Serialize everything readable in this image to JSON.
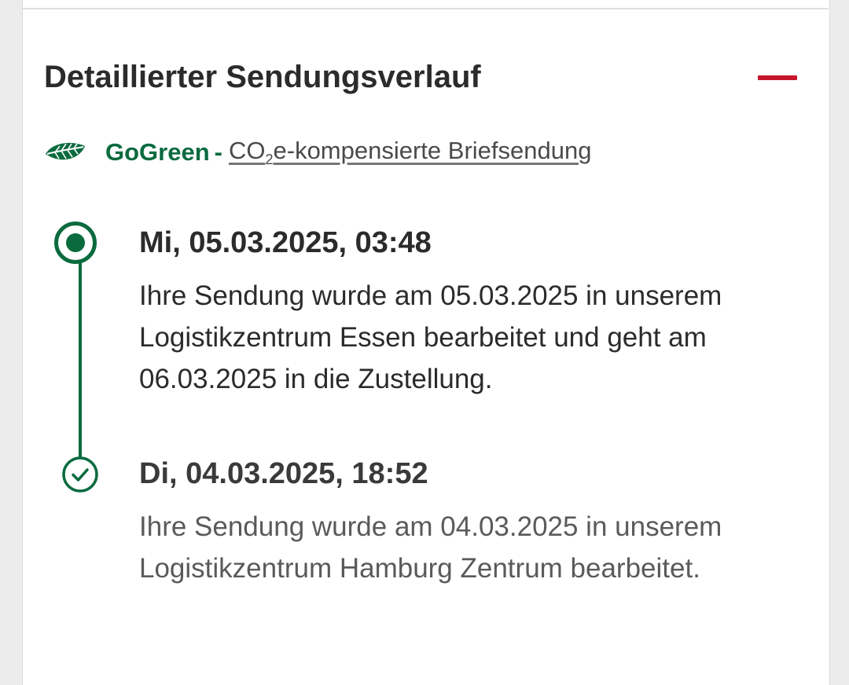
{
  "section": {
    "title": "Detaillierter Sendungsverlauf",
    "collapse_icon": "minus-icon",
    "accent_color": "#c6162d"
  },
  "gogreen": {
    "icon": "leaf-icon",
    "brand": "GoGreen",
    "separator": "-",
    "link_prefix": "CO",
    "link_sub": "2",
    "link_suffix": "e-kompensierte Briefsendung",
    "brand_color": "#0b6b3f"
  },
  "timeline": {
    "events": [
      {
        "date": "Mi, 05.03.2025, 03:48",
        "text": "Ihre Sendung wurde am 05.03.2025 in unserem Logistikzentrum Essen bearbeitet und geht am 06.03.2025 in die Zustellung.",
        "status": "current",
        "icon": "current-status-icon"
      },
      {
        "date": "Di, 04.03.2025, 18:52",
        "text": "Ihre Sendung wurde am 04.03.2025 in unserem Logistikzentrum Hamburg Zentrum bearbeitet.",
        "status": "done",
        "icon": "check-circle-icon"
      }
    ]
  }
}
